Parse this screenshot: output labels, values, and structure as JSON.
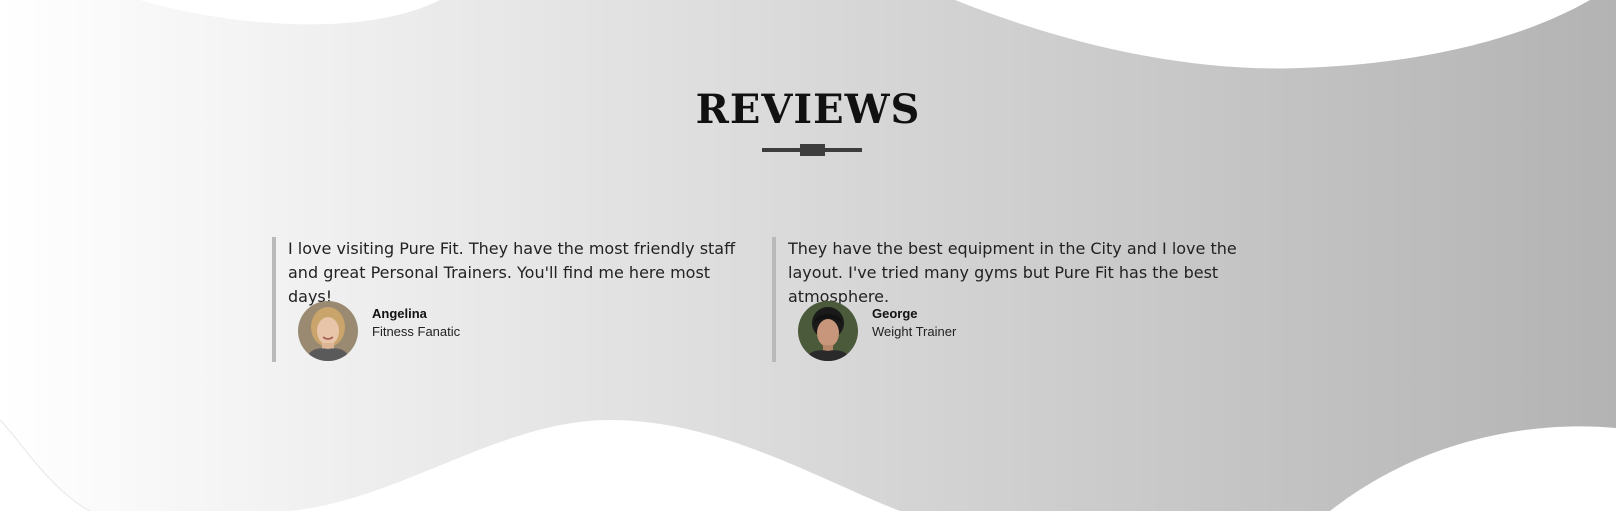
{
  "section": {
    "title": "REVIEWS"
  },
  "reviews": [
    {
      "quote": "I love visiting Pure Fit. They have the most friendly staff and great Personal Trainers. You'll find me here most days!",
      "name": "Angelina",
      "role": "Fitness Fanatic"
    },
    {
      "quote": "They have the best equipment in the City and I love the layout. I've tried many gyms but Pure Fit has the best atmosphere.",
      "name": "George",
      "role": "Weight Trainer"
    }
  ],
  "colors": {
    "gradient_start": "#ffffff",
    "gradient_end": "#b3b3b3",
    "accent_dark": "#3d3d3d",
    "quote_border": "#b9b9b9"
  }
}
